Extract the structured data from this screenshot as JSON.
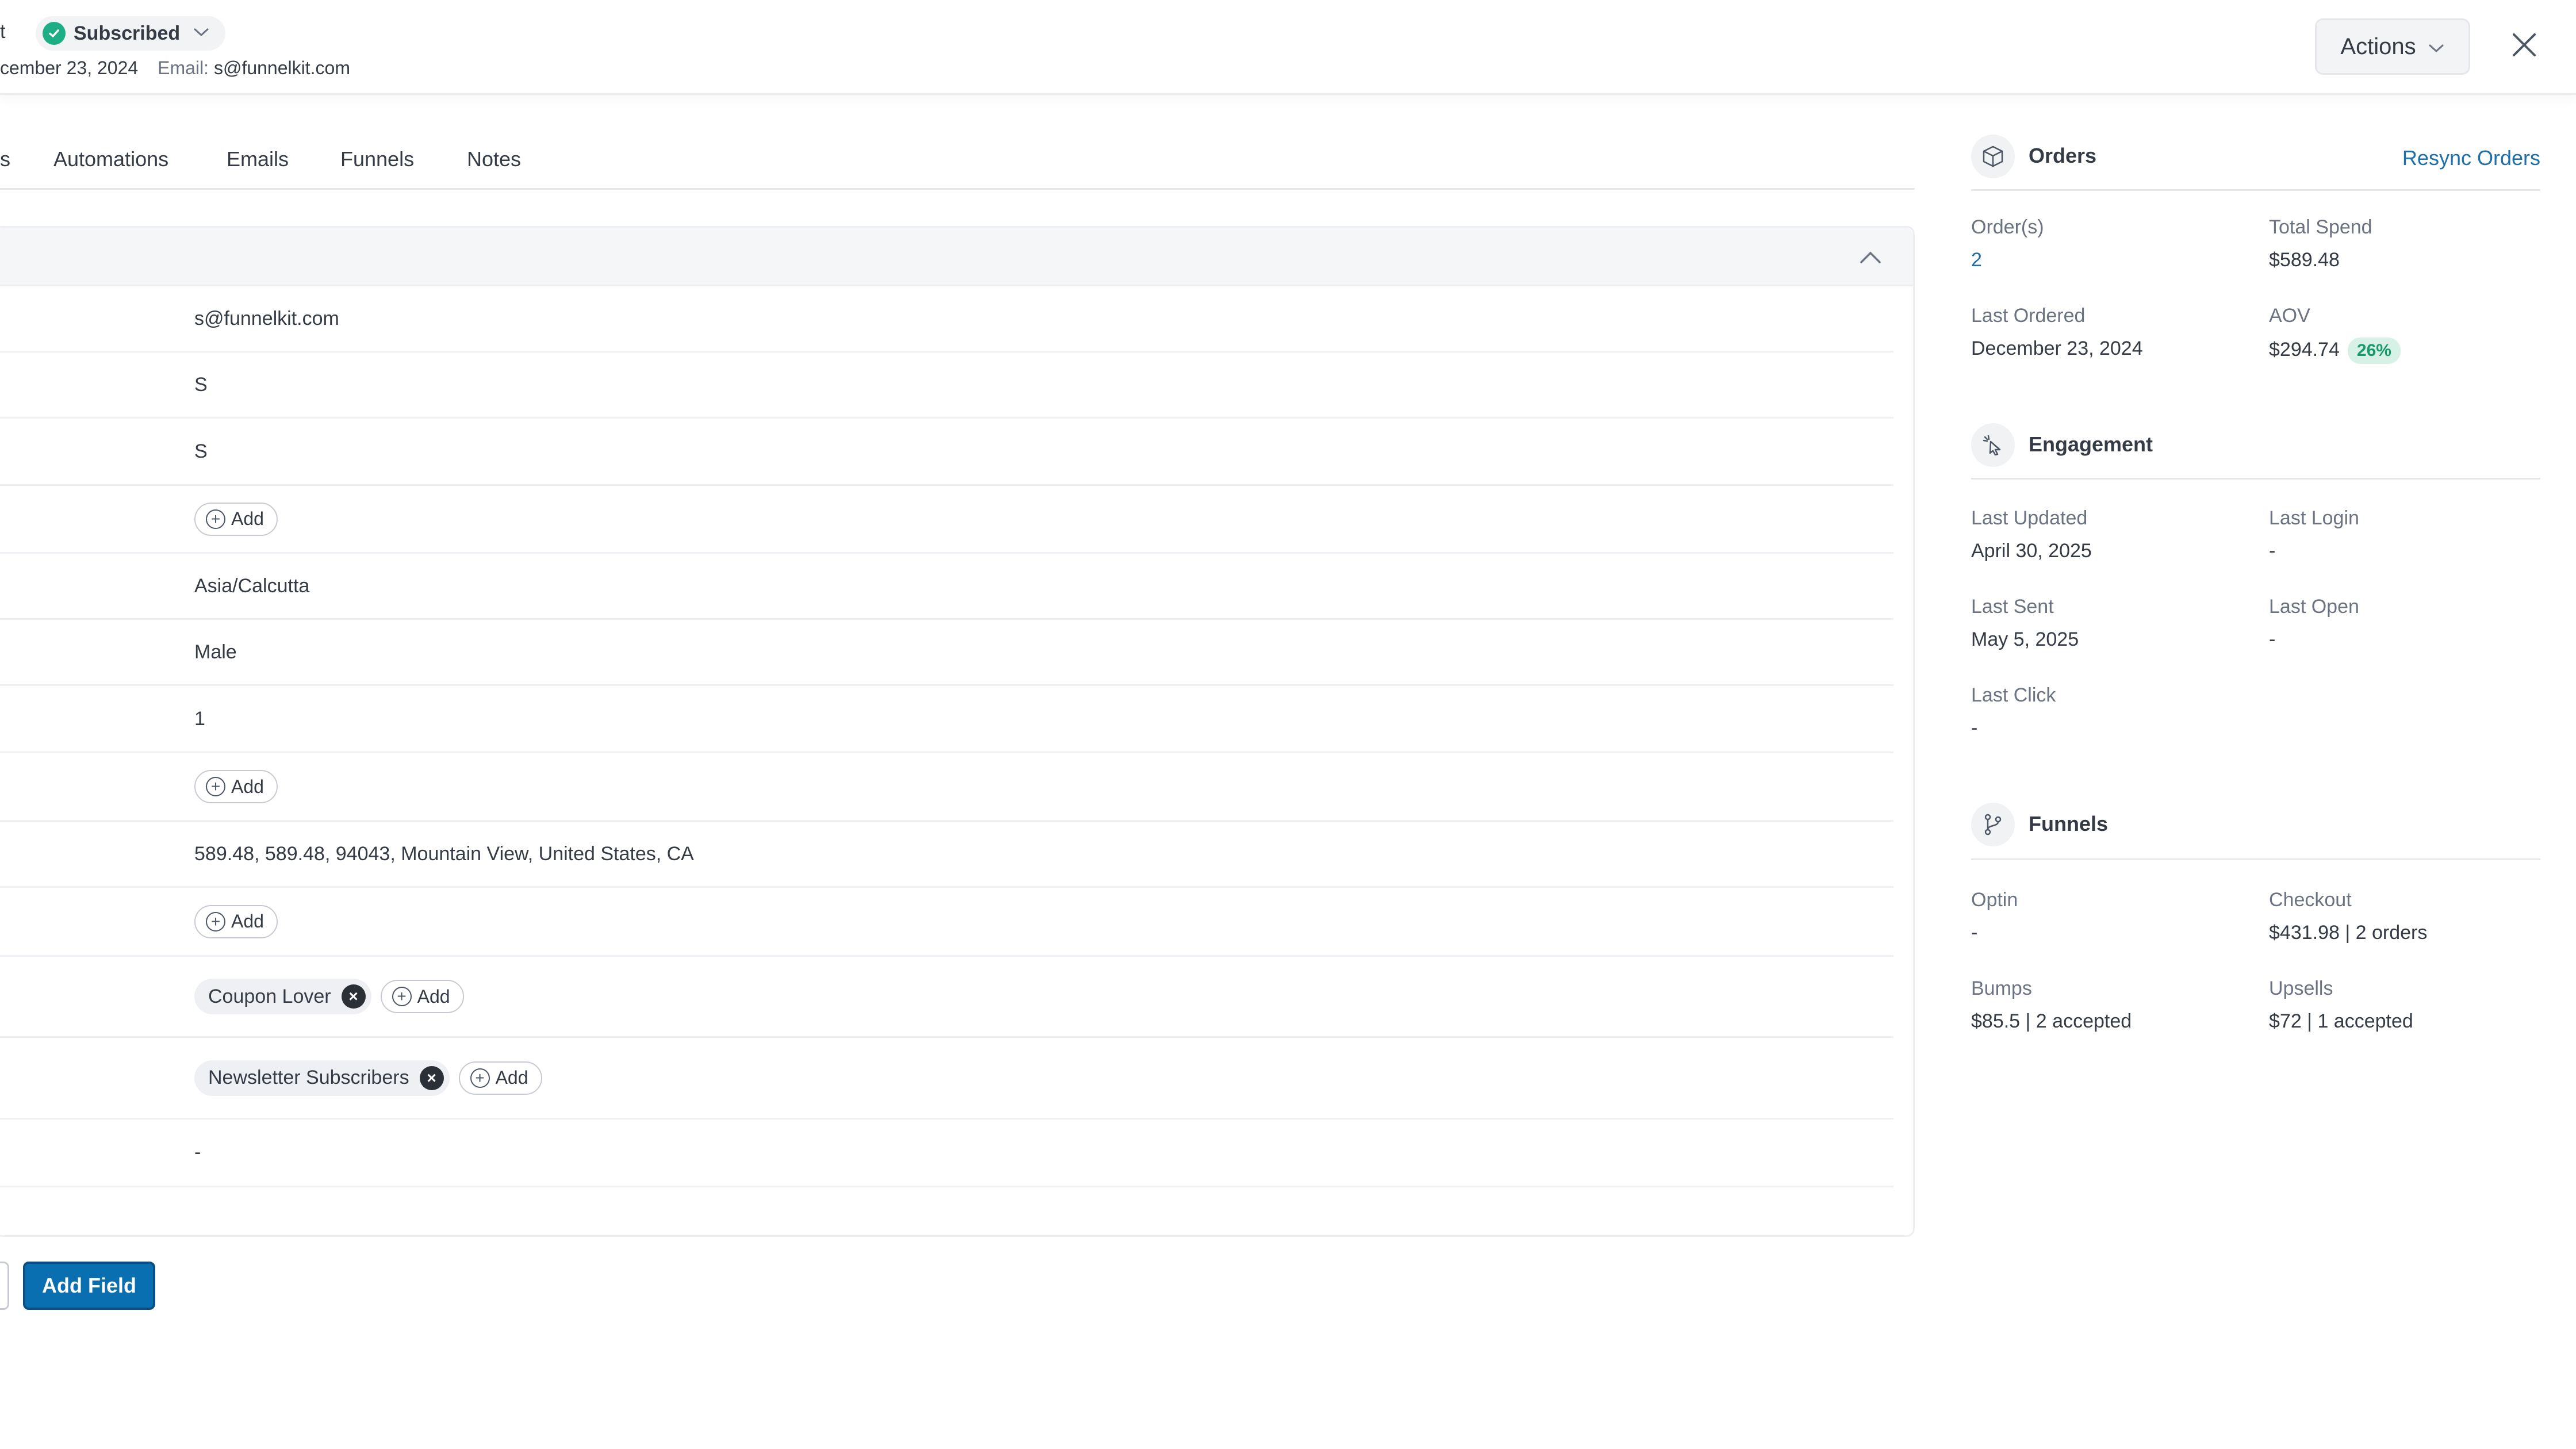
{
  "header": {
    "name_fragment": "t",
    "status": "Subscribed",
    "created_date": "cember 23, 2024",
    "email_label": "Email:",
    "email_value": "s@funnelkit.com",
    "actions_label": "Actions"
  },
  "tabs": {
    "fragment": "s",
    "items": [
      "Automations",
      "Emails",
      "Funnels",
      "Notes"
    ]
  },
  "fields": {
    "email": "s@funnelkit.com",
    "first_name": "S",
    "last_name": "S",
    "add_label": "Add",
    "timezone": "Asia/Calcutta",
    "gender": "Male",
    "number": "1",
    "address": "589.48, 589.48, 94043, Mountain View, United States, CA",
    "tag": "Coupon Lover",
    "list": "Newsletter Subscribers",
    "last": "-"
  },
  "add_field_label": "Add Field",
  "orders": {
    "title": "Orders",
    "resync_label": "Resync Orders",
    "orders_label": "Order(s)",
    "orders_value": "2",
    "total_spend_label": "Total Spend",
    "total_spend_value": "$589.48",
    "last_ordered_label": "Last Ordered",
    "last_ordered_value": "December 23, 2024",
    "aov_label": "AOV",
    "aov_value": "$294.74",
    "aov_pct": "26%"
  },
  "engagement": {
    "title": "Engagement",
    "last_updated_label": "Last Updated",
    "last_updated_value": "April 30, 2025",
    "last_login_label": "Last Login",
    "last_login_value": "-",
    "last_sent_label": "Last Sent",
    "last_sent_value": "May 5, 2025",
    "last_open_label": "Last Open",
    "last_open_value": "-",
    "last_click_label": "Last Click",
    "last_click_value": "-"
  },
  "funnels": {
    "title": "Funnels",
    "optin_label": "Optin",
    "optin_value": "-",
    "checkout_label": "Checkout",
    "checkout_value": "$431.98 | 2 orders",
    "bumps_label": "Bumps",
    "bumps_value": "$85.5 | 2 accepted",
    "upsells_label": "Upsells",
    "upsells_value": "$72 | 1 accepted"
  },
  "colors": {
    "accent": "#1f6fa8",
    "primary_button": "#0a6fb0",
    "success": "#1dae85"
  }
}
